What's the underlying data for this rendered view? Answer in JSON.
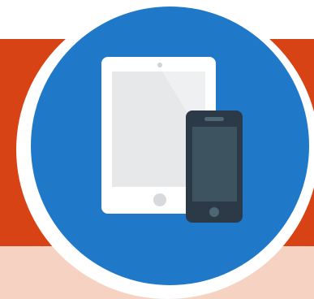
{
  "graphic": {
    "icon": "devices-icon",
    "devices": [
      "tablet-icon",
      "smartphone-icon"
    ],
    "colors": {
      "orange": "#d84315",
      "peach": "#f6d2c3",
      "blue": "#1f78c8",
      "tablet_body": "#ffffff",
      "tablet_screen": "#e6e8ea",
      "phone_body": "#2b3a46",
      "phone_screen": "#3d5360"
    }
  }
}
